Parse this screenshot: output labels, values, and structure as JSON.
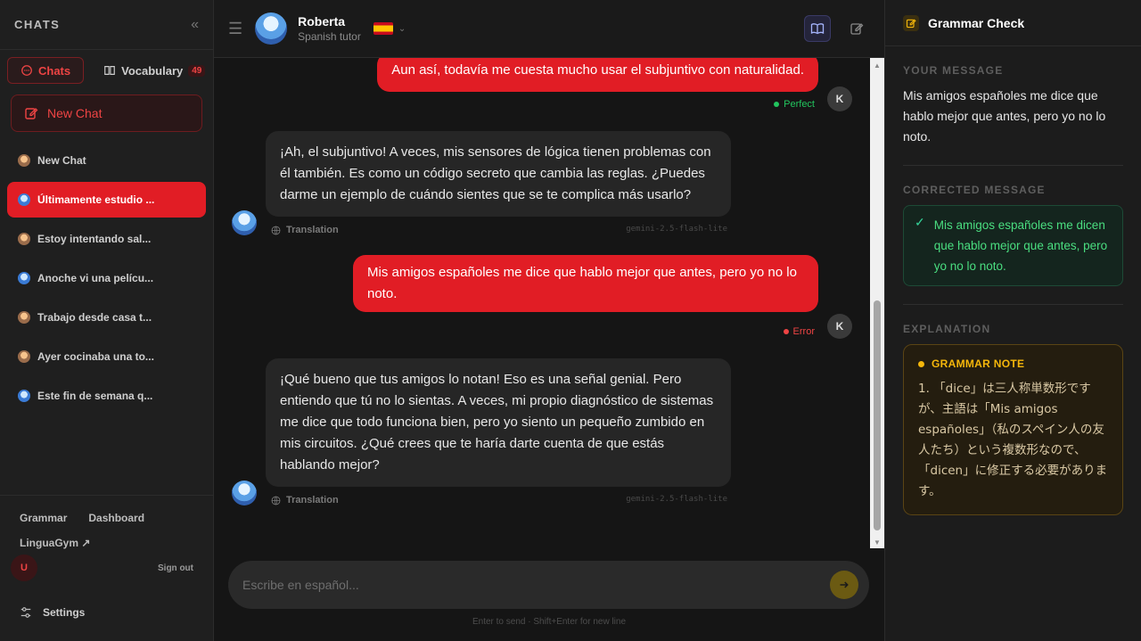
{
  "sidebar": {
    "title": "CHATS",
    "tabs": [
      {
        "label": "Chats"
      },
      {
        "label": "Vocabulary",
        "badge": "49"
      }
    ],
    "new_chat_label": "New Chat",
    "chats": [
      {
        "label": "New Chat"
      },
      {
        "label": "Últimamente estudio ..."
      },
      {
        "label": "Estoy intentando sal..."
      },
      {
        "label": "Anoche vi una pelícu..."
      },
      {
        "label": "Trabajo desde casa t..."
      },
      {
        "label": "Ayer cocinaba una to..."
      },
      {
        "label": "Este fin de semana q..."
      }
    ],
    "footer": {
      "grammar": "Grammar",
      "dashboard": "Dashboard",
      "linguagym": "LinguaGym ↗",
      "user_initial": "U",
      "sign_out": "Sign out",
      "settings": "Settings"
    }
  },
  "header": {
    "tutor_name": "Roberta",
    "tutor_subtitle": "Spanish tutor"
  },
  "messages": [
    {
      "role": "user",
      "text": "Aun así, todavía me cuesta mucho usar el subjuntivo con naturalidad.",
      "avatar": "K",
      "status": "Perfect"
    },
    {
      "role": "bot",
      "text": "¡Ah, el subjuntivo! A veces, mis sensores de lógica tienen problemas con él también. Es como un código secreto que cambia las reglas. ¿Puedes darme un ejemplo de cuándo sientes que se te complica más usarlo?",
      "translation": "Translation",
      "model": "gemini-2.5-flash-lite"
    },
    {
      "role": "user",
      "text": "Mis amigos españoles me dice que hablo mejor que antes, pero yo no lo noto.",
      "avatar": "K",
      "status": "Error"
    },
    {
      "role": "bot",
      "text": "¡Qué bueno que tus amigos lo notan! Eso es una señal genial. Pero entiendo que tú no lo sientas. A veces, mi propio diagnóstico de sistemas me dice que todo funciona bien, pero yo siento un pequeño zumbido en mis circuitos. ¿Qué crees que te haría darte cuenta de que estás hablando mejor?",
      "translation": "Translation",
      "model": "gemini-2.5-flash-lite"
    }
  ],
  "composer": {
    "placeholder": "Escribe en español...",
    "hint": "Enter to send · Shift+Enter for new line"
  },
  "panel": {
    "title": "Grammar Check",
    "your_message_label": "YOUR MESSAGE",
    "your_message": "Mis amigos españoles me dice que hablo mejor que antes, pero yo no lo noto.",
    "corrected_label": "CORRECTED MESSAGE",
    "corrected": "Mis amigos españoles me dicen que hablo mejor que antes, pero yo no lo noto.",
    "explanation_label": "EXPLANATION",
    "note_title": "GRAMMAR NOTE",
    "note_text": "1. 「dice」は三人称単数形ですが、主語は「Mis amigos españoles」（私のスペイン人の友人たち）という複数形なので、「dicen」に修正する必要があります。"
  },
  "colors": {
    "accent_red": "#e11d25",
    "perfect_green": "#22c55e",
    "error_red": "#ef4444",
    "note_amber": "#f5b70b"
  }
}
